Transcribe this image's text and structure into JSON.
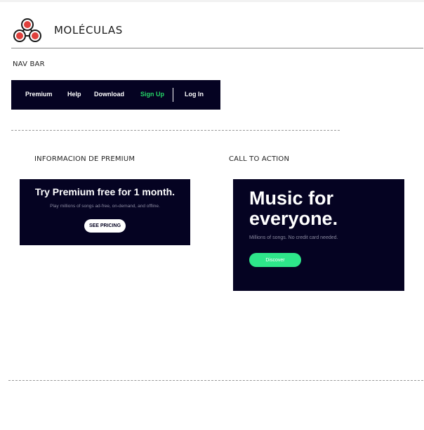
{
  "header": {
    "title": "MOLÉCULAS",
    "logo_icon": "molecule-logo-icon"
  },
  "sections": {
    "nav_bar_label": "NAV BAR",
    "premium_label": "INFORMACION DE PREMIUM",
    "cta_label": "CALL TO ACTION"
  },
  "navbar": {
    "items": [
      "Premium",
      "Help",
      "Download",
      "Sign Up",
      "Log In"
    ]
  },
  "premium_card": {
    "title": "Try Premium free for 1 month.",
    "subtitle": "Play millions of songs ad-free, on-demand, and offline.",
    "button_label": "SEE PRICING"
  },
  "cta_card": {
    "title_line1": "Music for",
    "title_line2": "everyone.",
    "subtitle": "Millions of songs. No credit card needed.",
    "button_label": "Discover"
  },
  "colors": {
    "dark_background": "#050322",
    "accent_green": "#2ee68a",
    "logo_red": "#e0403c"
  }
}
